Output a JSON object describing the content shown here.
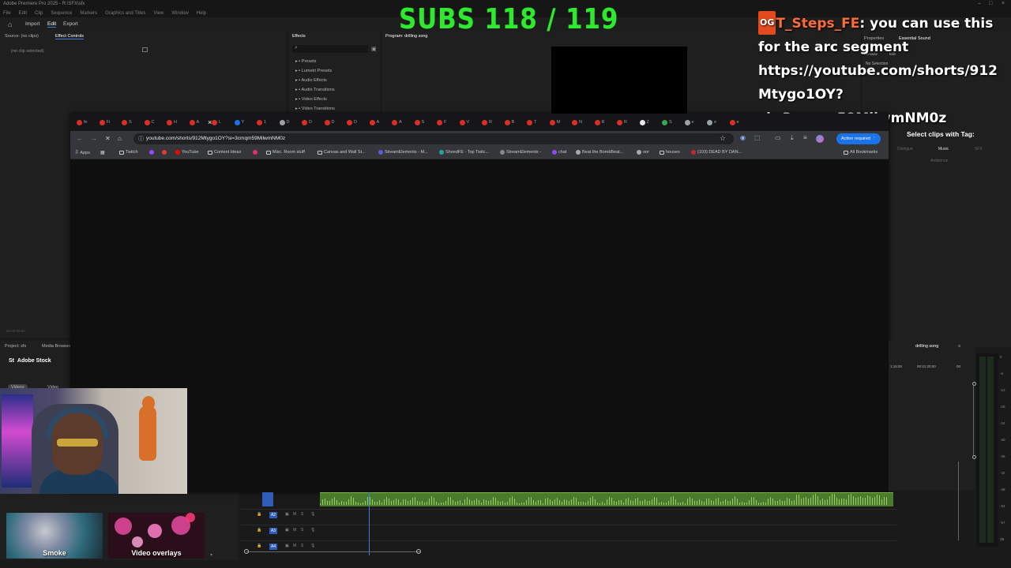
{
  "premiere": {
    "app_title": "Adobe Premiere Pro 2025 - R:\\SFX\\sfx",
    "menu": [
      "File",
      "Edit",
      "Clip",
      "Sequence",
      "Markers",
      "Graphics and Titles",
      "View",
      "Window",
      "Help"
    ],
    "workspace_tabs": [
      "Import",
      "Edit",
      "Export"
    ],
    "active_workspace": "Edit",
    "source_panel_tabs": [
      "Source: (no clips)",
      "Effect Controls"
    ],
    "no_clip_text": "(no clip selected)",
    "source_timecode": "00:00:00:00",
    "effects_panel_title": "Effects",
    "effects_list": [
      "Presets",
      "Lumetri Presets",
      "Audio Effects",
      "Audio Transitions",
      "Video Effects",
      "Video Transitions"
    ],
    "program_title": "Program: drilling song",
    "essential_sound_tabs": [
      "Properties",
      "Essential Sound"
    ],
    "essential_sound_sub": [
      "Browse",
      "Edit"
    ],
    "no_selection": "No Selection",
    "select_clips_tag": "Select clips with Tag:",
    "tags": [
      "Dialogue",
      "Music",
      "SFX",
      "Ambience"
    ],
    "project_tabs": [
      "Project: sfx",
      "Media Browser"
    ],
    "adobe_stock": "Adobe Stock",
    "stock_tabs": [
      "Videos",
      "Video"
    ],
    "thumbnails": [
      "Smoke",
      "Video overlays"
    ],
    "sequence_tab": "drilling song",
    "timeline_timecodes": [
      "1:15:00",
      "00:01:20:00",
      "00"
    ],
    "audio_tracks": [
      "A2",
      "A3",
      "A4"
    ],
    "track_buttons": [
      "M",
      "S"
    ],
    "vu_scale": [
      "0",
      "-6",
      "-12",
      "-18",
      "-24",
      "-30",
      "-36",
      "-42",
      "-48",
      "-54",
      "-57",
      "dB"
    ]
  },
  "overlay": {
    "subs_text": "SUBS 118 / 119",
    "chat_badge": "OG",
    "chat_user": "T_Steps_FE",
    "chat_message_lines": [
      ": you can use this",
      "for the arc segment",
      "https://youtube.com/shorts/912",
      "Mtygo1OY?",
      "si=3cmqm59MilwmNM0z"
    ]
  },
  "browser": {
    "tab_letters": [
      "fe",
      "Fi",
      "S",
      "C",
      "H",
      "A",
      "L",
      "Y",
      "1",
      "D",
      "D",
      "D",
      "D",
      "A",
      "A",
      "S",
      "F",
      "V",
      "R",
      "B",
      "T",
      "M",
      "N",
      "R",
      "R",
      "Z",
      "S",
      "e",
      "e",
      "e"
    ],
    "url": "youtube.com/shorts/912Mtygo1OY?si=3cmqm59MilwmNM0z",
    "action_required": "Action required",
    "bookmarks": [
      "Apps",
      "Twitch",
      "YouTube",
      "Content Ideas",
      "Misc. Room stuff",
      "Canvas and Wall St...",
      "StreamElements - M...",
      "SheedFE - Top Twitc...",
      "StreamElements -",
      "chat",
      "Beat the BombBeat...",
      "oor",
      "houses",
      "(103) DEAD BY DAN..."
    ],
    "all_bookmarks": "All Bookmarks"
  }
}
